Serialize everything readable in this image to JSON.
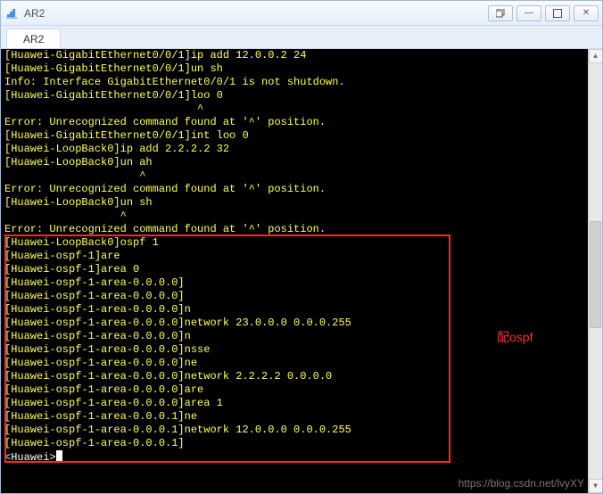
{
  "window": {
    "title": "AR2",
    "tabs": [
      {
        "label": "AR2"
      }
    ]
  },
  "annotation": "配ospf",
  "watermark": "https://blog.csdn.net/lvyXY",
  "terminal": {
    "prompt": "<Huawei>",
    "lines": [
      {
        "cls": "yellow",
        "txt": "[Huawei-GigabitEthernet0/0/1]ip add 12.0.0.2 24"
      },
      {
        "cls": "yellow",
        "txt": "[Huawei-GigabitEthernet0/0/1]un sh"
      },
      {
        "cls": "yellow",
        "txt": "Info: Interface GigabitEthernet0/0/1 is not shutdown."
      },
      {
        "cls": "yellow",
        "txt": "[Huawei-GigabitEthernet0/0/1]loo 0"
      },
      {
        "cls": "yellow",
        "txt": "                              ^"
      },
      {
        "cls": "yellow",
        "txt": "Error: Unrecognized command found at '^' position."
      },
      {
        "cls": "yellow",
        "txt": "[Huawei-GigabitEthernet0/0/1]int loo 0"
      },
      {
        "cls": "yellow",
        "txt": "[Huawei-LoopBack0]ip add 2.2.2.2 32"
      },
      {
        "cls": "yellow",
        "txt": "[Huawei-LoopBack0]un ah"
      },
      {
        "cls": "yellow",
        "txt": "                     ^"
      },
      {
        "cls": "yellow",
        "txt": "Error: Unrecognized command found at '^' position."
      },
      {
        "cls": "yellow",
        "txt": "[Huawei-LoopBack0]un sh"
      },
      {
        "cls": "yellow",
        "txt": "                  ^"
      },
      {
        "cls": "yellow",
        "txt": "Error: Unrecognized command found at '^' position."
      },
      {
        "cls": "yellow",
        "txt": "[Huawei-LoopBack0]ospf 1"
      },
      {
        "cls": "yellow",
        "txt": "[Huawei-ospf-1]are"
      },
      {
        "cls": "yellow",
        "txt": "[Huawei-ospf-1]area 0"
      },
      {
        "cls": "yellow",
        "txt": "[Huawei-ospf-1-area-0.0.0.0]"
      },
      {
        "cls": "yellow",
        "txt": "[Huawei-ospf-1-area-0.0.0.0]"
      },
      {
        "cls": "yellow",
        "txt": "[Huawei-ospf-1-area-0.0.0.0]n"
      },
      {
        "cls": "yellow",
        "txt": "[Huawei-ospf-1-area-0.0.0.0]network 23.0.0.0 0.0.0.255"
      },
      {
        "cls": "yellow",
        "txt": "[Huawei-ospf-1-area-0.0.0.0]n"
      },
      {
        "cls": "yellow",
        "txt": "[Huawei-ospf-1-area-0.0.0.0]nsse"
      },
      {
        "cls": "yellow",
        "txt": "[Huawei-ospf-1-area-0.0.0.0]ne"
      },
      {
        "cls": "yellow",
        "txt": "[Huawei-ospf-1-area-0.0.0.0]network 2.2.2.2 0.0.0.0"
      },
      {
        "cls": "yellow",
        "txt": "[Huawei-ospf-1-area-0.0.0.0]are"
      },
      {
        "cls": "yellow",
        "txt": "[Huawei-ospf-1-area-0.0.0.0]area 1"
      },
      {
        "cls": "yellow",
        "txt": "[Huawei-ospf-1-area-0.0.0.1]ne"
      },
      {
        "cls": "yellow",
        "txt": "[Huawei-ospf-1-area-0.0.0.1]network 12.0.0.0 0.0.0.255"
      },
      {
        "cls": "yellow",
        "txt": "[Huawei-ospf-1-area-0.0.0.1]"
      }
    ]
  }
}
